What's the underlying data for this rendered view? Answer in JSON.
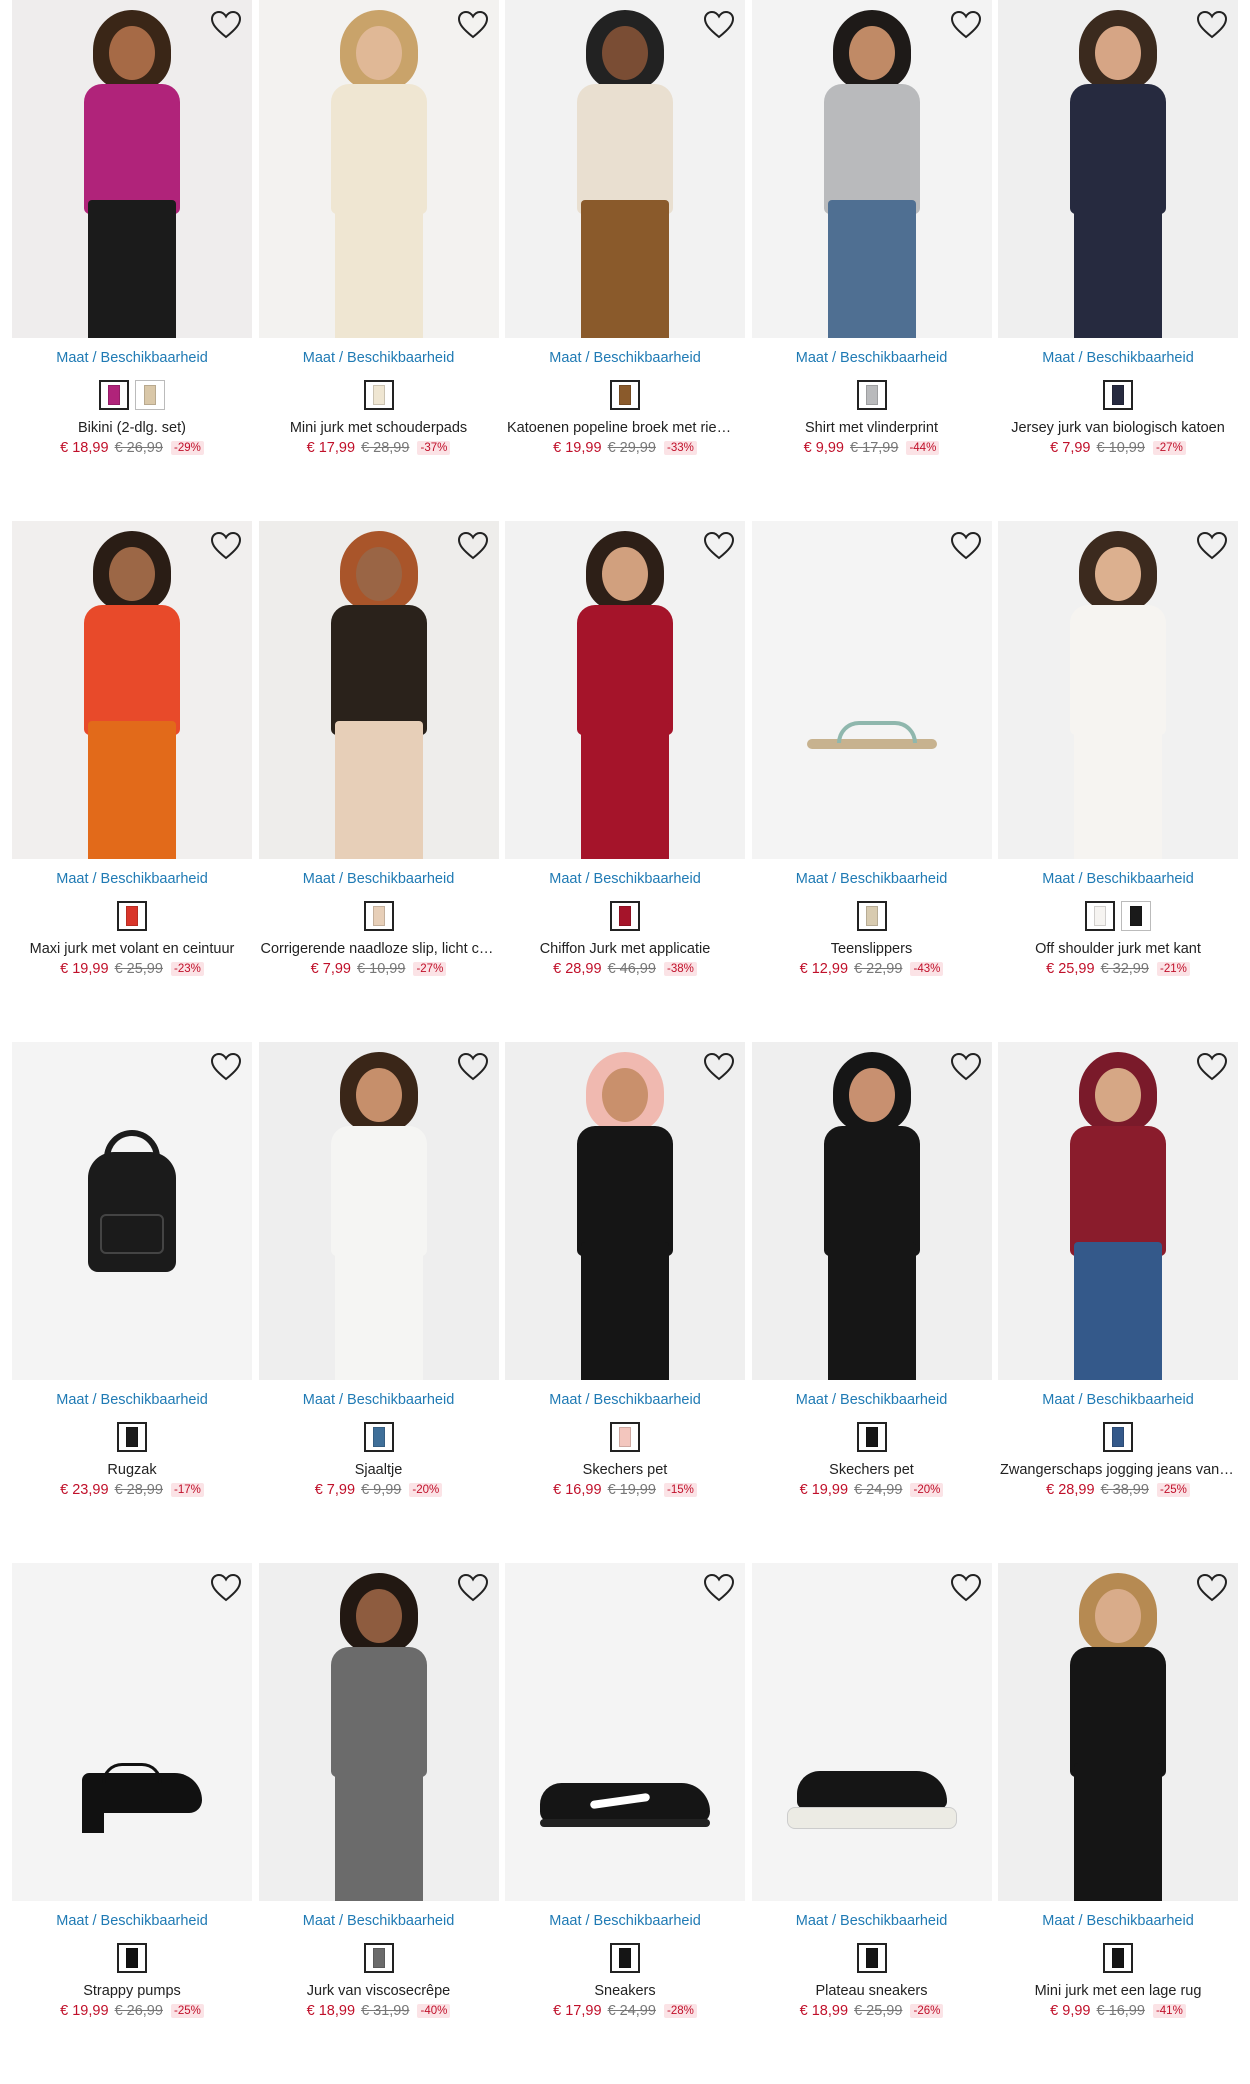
{
  "availability_label": "Maat / Beschikbaarheid",
  "products": [
    {
      "name": "Bikini (2-dlg. set)",
      "price": "€ 18,99",
      "old_price": "€ 26,99",
      "discount": "-29%",
      "image": {
        "kind": "model",
        "bg": "#efeded",
        "skin": "#a66a46",
        "hair": "#3a2617",
        "top": "#b0237a",
        "bottom": "#1b1b1b"
      },
      "swatches": [
        {
          "color": "#b0237a",
          "selected": true
        },
        {
          "color": "#d9c7a8",
          "selected": false
        }
      ]
    },
    {
      "name": "Mini jurk met schouderpads",
      "price": "€ 17,99",
      "old_price": "€ 28,99",
      "discount": "-37%",
      "image": {
        "kind": "model",
        "bg": "#f3f2f0",
        "skin": "#e0b896",
        "hair": "#c9a36a",
        "top": "#efe6d2",
        "bottom": "#efe6d2"
      },
      "swatches": [
        {
          "color": "#efe6d2",
          "selected": true
        }
      ]
    },
    {
      "name": "Katoenen popeline broek met riem en wijde pijpen",
      "price": "€ 19,99",
      "old_price": "€ 29,99",
      "discount": "-33%",
      "image": {
        "kind": "model",
        "bg": "#f2f2f2",
        "skin": "#7a4d34",
        "hair": "#222",
        "top": "#e9dfd0",
        "bottom": "#8a5a2b"
      },
      "swatches": [
        {
          "color": "#8a5a2b",
          "selected": true
        }
      ]
    },
    {
      "name": "Shirt met vlinderprint",
      "price": "€ 9,99",
      "old_price": "€ 17,99",
      "discount": "-44%",
      "image": {
        "kind": "model",
        "bg": "#f3f3f3",
        "skin": "#c08a66",
        "hair": "#1e1a18",
        "top": "#b9babc",
        "bottom": "#4f6f92"
      },
      "swatches": [
        {
          "color": "#b9babc",
          "selected": true
        }
      ]
    },
    {
      "name": "Jersey jurk van biologisch katoen",
      "price": "€ 7,99",
      "old_price": "€ 10,99",
      "discount": "-27%",
      "image": {
        "kind": "model",
        "bg": "#efefef",
        "skin": "#d6a585",
        "hair": "#3b2a1e",
        "top": "#262a3f",
        "bottom": "#262a3f"
      },
      "swatches": [
        {
          "color": "#262a3f",
          "selected": true
        }
      ]
    },
    {
      "name": "Maxi jurk met volant en ceintuur",
      "price": "€ 19,99",
      "old_price": "€ 25,99",
      "discount": "-23%",
      "image": {
        "kind": "model",
        "bg": "#f1efee",
        "skin": "#9c6746",
        "hair": "#2a1d15",
        "top": "#e84a2a",
        "bottom": "#e26a1a"
      },
      "swatches": [
        {
          "color": "#d9352a",
          "selected": true
        }
      ]
    },
    {
      "name": "Corrigerende naadloze slip, licht corrigerend",
      "price": "€ 7,99",
      "old_price": "€ 10,99",
      "discount": "-27%",
      "image": {
        "kind": "model",
        "bg": "#eeedeb",
        "skin": "#9a6545",
        "hair": "#a9552a",
        "top": "#2a221b",
        "bottom": "#e7cfb8"
      },
      "swatches": [
        {
          "color": "#e7cfb8",
          "selected": true
        }
      ]
    },
    {
      "name": "Chiffon Jurk met applicatie",
      "price": "€ 28,99",
      "old_price": "€ 46,99",
      "discount": "-38%",
      "image": {
        "kind": "model",
        "bg": "#f2f2f2",
        "skin": "#d1a07e",
        "hair": "#2d1f17",
        "top": "#a5142a",
        "bottom": "#a5142a"
      },
      "swatches": [
        {
          "color": "#a5142a",
          "selected": true
        }
      ]
    },
    {
      "name": "Teenslippers",
      "price": "€ 12,99",
      "old_price": "€ 22,99",
      "discount": "-43%",
      "image": {
        "kind": "sandal",
        "bg": "#f4f4f4",
        "color": "#c7b28f"
      },
      "swatches": [
        {
          "color": "#d8cbb0",
          "selected": true
        }
      ]
    },
    {
      "name": "Off shoulder jurk met kant",
      "price": "€ 25,99",
      "old_price": "€ 32,99",
      "discount": "-21%",
      "image": {
        "kind": "model",
        "bg": "#f1f1f1",
        "skin": "#dcb08f",
        "hair": "#3c2a1e",
        "top": "#f6f4f1",
        "bottom": "#f6f4f1"
      },
      "swatches": [
        {
          "color": "#f6f4f1",
          "selected": true
        },
        {
          "color": "#1a1a1a",
          "selected": false
        }
      ]
    },
    {
      "name": "Rugzak",
      "price": "€ 23,99",
      "old_price": "€ 28,99",
      "discount": "-17%",
      "image": {
        "kind": "backpack",
        "bg": "#f4f4f4",
        "color": "#1b1b1b"
      },
      "swatches": [
        {
          "color": "#1b1b1b",
          "selected": true
        }
      ]
    },
    {
      "name": "Sjaaltje",
      "price": "€ 7,99",
      "old_price": "€ 9,99",
      "discount": "-20%",
      "image": {
        "kind": "model",
        "bg": "#eeeeee",
        "skin": "#c68f6b",
        "hair": "#3a2618",
        "top": "#f5f5f3",
        "bottom": "#f5f5f3"
      },
      "swatches": [
        {
          "color": "#3f6f99",
          "selected": true
        }
      ]
    },
    {
      "name": "Skechers pet",
      "price": "€ 16,99",
      "old_price": "€ 19,99",
      "discount": "-15%",
      "image": {
        "kind": "model",
        "bg": "#efefef",
        "skin": "#c9906c",
        "hair": "#f0b9b0",
        "top": "#151515",
        "bottom": "#151515"
      },
      "swatches": [
        {
          "color": "#f3c6be",
          "selected": true
        }
      ]
    },
    {
      "name": "Skechers pet",
      "price": "€ 19,99",
      "old_price": "€ 24,99",
      "discount": "-20%",
      "image": {
        "kind": "model",
        "bg": "#efefef",
        "skin": "#c89070",
        "hair": "#161616",
        "top": "#161616",
        "bottom": "#161616"
      },
      "swatches": [
        {
          "color": "#161616",
          "selected": true
        }
      ]
    },
    {
      "name": "Zwangerschaps jogging jeans van biologisch katoen",
      "price": "€ 28,99",
      "old_price": "€ 38,99",
      "discount": "-25%",
      "image": {
        "kind": "model",
        "bg": "#f1f1f1",
        "skin": "#d6a785",
        "hair": "#7a1a2a",
        "top": "#8a1c2c",
        "bottom": "#34598a"
      },
      "swatches": [
        {
          "color": "#34598a",
          "selected": true
        }
      ]
    },
    {
      "name": "Strappy pumps",
      "price": "€ 19,99",
      "old_price": "€ 26,99",
      "discount": "-25%",
      "image": {
        "kind": "pump",
        "bg": "#f4f4f4",
        "color": "#111"
      },
      "swatches": [
        {
          "color": "#111111",
          "selected": true
        }
      ]
    },
    {
      "name": "Jurk van viscosecrêpe",
      "price": "€ 18,99",
      "old_price": "€ 31,99",
      "discount": "-40%",
      "image": {
        "kind": "model",
        "bg": "#efefef",
        "skin": "#8e5c3f",
        "hair": "#221812",
        "top": "#6b6b6b",
        "bottom": "#6b6b6b"
      },
      "swatches": [
        {
          "color": "#6b6b6b",
          "selected": true
        }
      ]
    },
    {
      "name": "Sneakers",
      "price": "€ 17,99",
      "old_price": "€ 24,99",
      "discount": "-28%",
      "image": {
        "kind": "sneaker",
        "bg": "#f4f4f4",
        "color": "#151515",
        "accent": "#ffffff"
      },
      "swatches": [
        {
          "color": "#151515",
          "selected": true
        }
      ]
    },
    {
      "name": "Plateau sneakers",
      "price": "€ 18,99",
      "old_price": "€ 25,99",
      "discount": "-26%",
      "image": {
        "kind": "platform",
        "bg": "#f4f4f4",
        "color": "#151515",
        "accent": "#ecebe4"
      },
      "swatches": [
        {
          "color": "#151515",
          "selected": true
        }
      ]
    },
    {
      "name": "Mini jurk met een lage rug",
      "price": "€ 9,99",
      "old_price": "€ 16,99",
      "discount": "-41%",
      "image": {
        "kind": "model",
        "bg": "#efefef",
        "skin": "#d9ac8a",
        "hair": "#b68a52",
        "top": "#151515",
        "bottom": "#151515"
      },
      "swatches": [
        {
          "color": "#151515",
          "selected": true
        }
      ]
    }
  ]
}
